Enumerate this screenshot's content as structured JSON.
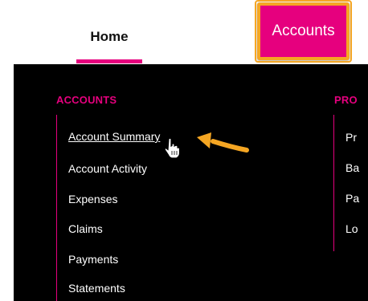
{
  "topnav": {
    "home_label": "Home",
    "accounts_label": "Accounts"
  },
  "dropdown": {
    "column1": {
      "title": "ACCOUNTS",
      "items": [
        "Account Summary",
        "Account Activity",
        "Expenses",
        "Claims",
        "Payments",
        "Statements"
      ]
    },
    "column2": {
      "title": "PRO",
      "items": [
        "Pr",
        "Ba",
        "Pa",
        "Lo"
      ]
    }
  },
  "colors": {
    "accent": "#e6007e",
    "highlight": "#f5a623",
    "menu_background": "#000000"
  },
  "annotations": {
    "arrow_icon": "yellow-arrow-icon",
    "cursor_icon": "hand-pointer-icon"
  }
}
